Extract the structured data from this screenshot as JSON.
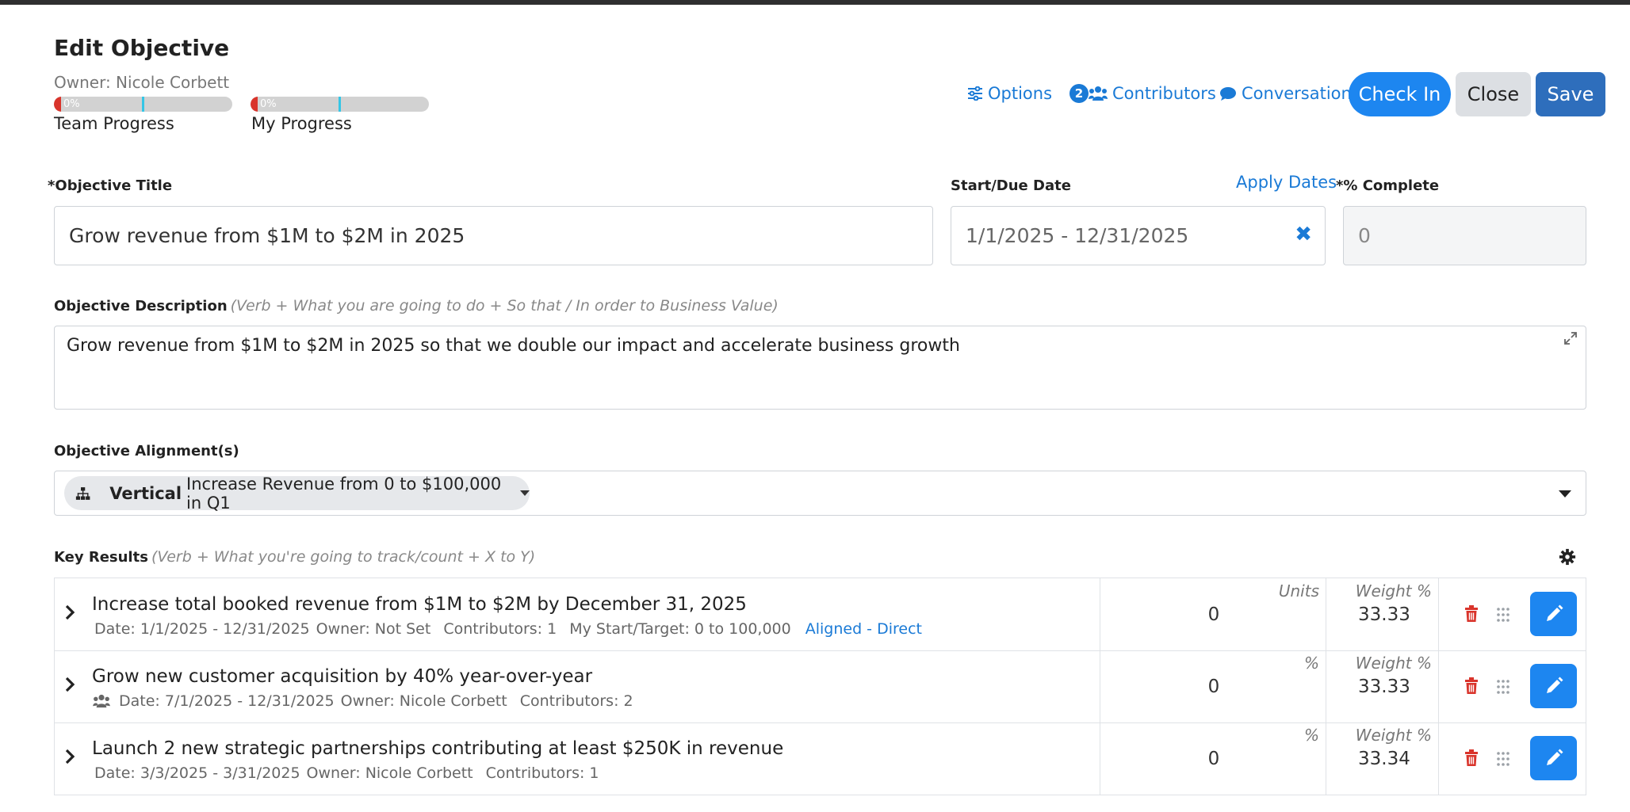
{
  "header": {
    "title": "Edit Objective",
    "owner": "Owner: Nicole Corbett",
    "team_progress": {
      "label": "Team Progress",
      "value_text": "0%",
      "value": 0
    },
    "my_progress": {
      "label": "My Progress",
      "value_text": "0%",
      "value": 0
    }
  },
  "toolbar": {
    "options_label": "Options",
    "contributors_count": "2",
    "contributors_label": "Contributors",
    "conversation_label": "Conversation",
    "checkin_label": "Check In",
    "close_label": "Close",
    "save_label": "Save"
  },
  "form": {
    "title_label": "*Objective Title",
    "title_value": "Grow revenue from $1M to $2M in 2025",
    "date_label": "Start/Due Date",
    "apply_dates_label": "Apply Dates",
    "date_value": "1/1/2025 - 12/31/2025",
    "complete_label": "*% Complete",
    "complete_value": "0",
    "description_label": "Objective Description",
    "description_hint": "(Verb + What you are going to do + So that / In order to Business Value)",
    "description_value": "Grow revenue from $1M to $2M in 2025 so that we double our impact and accelerate business growth",
    "alignment_label": "Objective Alignment(s)",
    "alignment": {
      "type": "Vertical",
      "text": "Increase Revenue from 0 to $100,000 in Q1"
    }
  },
  "key_results": {
    "label": "Key Results",
    "hint": "(Verb + What you're going to track/count + X to Y)",
    "rows": [
      {
        "title": "Increase total booked revenue from $1M to $2M by December 31, 2025",
        "date": "Date: 1/1/2025 - 12/31/2025",
        "owner": "Owner: Not Set",
        "contributors": "Contributors: 1",
        "target": "My Start/Target: 0 to 100,000",
        "aligned": "Aligned - Direct",
        "unit_label": "Units",
        "value": "0",
        "weight_label": "Weight %",
        "weight": "33.33"
      },
      {
        "title": "Grow new customer acquisition by 40% year-over-year",
        "date": "Date: 7/1/2025 - 12/31/2025",
        "owner": "Owner: Nicole Corbett",
        "contributors": "Contributors: 2",
        "unit_label": "%",
        "value": "0",
        "weight_label": "Weight %",
        "weight": "33.33"
      },
      {
        "title": "Launch 2 new strategic partnerships contributing at least $250K in revenue",
        "date": "Date: 3/3/2025 - 3/31/2025",
        "owner": "Owner: Nicole Corbett",
        "contributors": "Contributors: 1",
        "unit_label": "%",
        "value": "0",
        "weight_label": "Weight %",
        "weight": "33.34"
      }
    ]
  },
  "colors": {
    "accent": "#1d86f0",
    "link": "#1a7ad6",
    "save": "#2e6ebc",
    "danger": "#d9342b",
    "progress_marker": "#35c6e6"
  }
}
